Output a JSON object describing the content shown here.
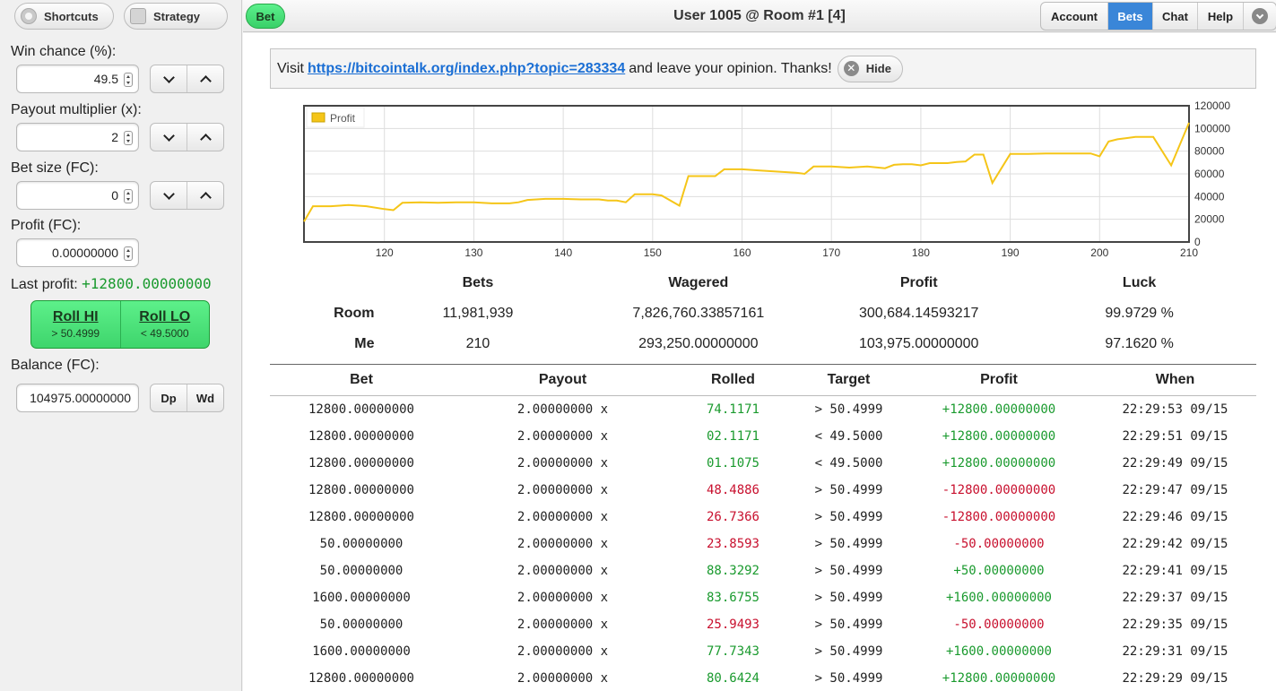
{
  "sidebar": {
    "shortcuts_label": "Shortcuts",
    "strategy_label": "Strategy",
    "win_chance_label": "Win chance (%):",
    "win_chance_value": "49.5",
    "payout_label": "Payout multiplier (x):",
    "payout_value": "2",
    "bet_size_label": "Bet size (FC):",
    "bet_size_value": "0",
    "profit_label": "Profit (FC):",
    "profit_value": "0.00000000",
    "last_profit_label": "Last profit:",
    "last_profit_value": "+12800.00000000",
    "roll_hi_label": "Roll HI",
    "roll_hi_sub": "> 50.4999",
    "roll_lo_label": "Roll LO",
    "roll_lo_sub": "< 49.5000",
    "balance_label": "Balance (FC):",
    "balance_value": "104975.00000000",
    "deposit_label": "Dp",
    "withdraw_label": "Wd"
  },
  "header": {
    "bet_tab": "Bet",
    "title": "User 1005 @ Room #1 [4]",
    "nav": [
      "Account",
      "Bets",
      "Chat",
      "Help"
    ],
    "active_nav": "Bets"
  },
  "notice": {
    "prefix": "Visit",
    "link": "https://bitcointalk.org/index.php?topic=283334",
    "suffix": "and leave your opinion. Thanks!",
    "hide_label": "Hide"
  },
  "chart_data": {
    "type": "line",
    "legend": "Profit",
    "legend_position": "top-left",
    "series_color": "#f5c518",
    "grid": true,
    "xlim": [
      111,
      210
    ],
    "ylim": [
      0,
      120000
    ],
    "xticks": [
      120,
      130,
      140,
      150,
      160,
      170,
      180,
      190,
      200,
      210
    ],
    "yticks": [
      0,
      20000,
      40000,
      60000,
      80000,
      100000,
      120000
    ],
    "series": [
      {
        "name": "Profit",
        "x": [
          111,
          112,
          114,
          116,
          118,
          120,
          121,
          122,
          124,
          126,
          128,
          130,
          132,
          134,
          135,
          136,
          138,
          140,
          142,
          144,
          145,
          146,
          147,
          148,
          150,
          151,
          153,
          154,
          155,
          156,
          157,
          158,
          160,
          162,
          164,
          166,
          167,
          168,
          170,
          172,
          173,
          174,
          176,
          177,
          178,
          179,
          180,
          181,
          183,
          184,
          185,
          186,
          187,
          188,
          190,
          192,
          194,
          195,
          196,
          197,
          199,
          200,
          201,
          202,
          203,
          204,
          206,
          208,
          210
        ],
        "y": [
          18000,
          31500,
          31500,
          32500,
          31500,
          29000,
          28000,
          34500,
          35000,
          34500,
          35000,
          35000,
          34000,
          34000,
          35000,
          37000,
          38000,
          38000,
          37500,
          37500,
          36500,
          36500,
          35000,
          42000,
          42000,
          41000,
          32000,
          58000,
          58000,
          58000,
          58000,
          64000,
          64000,
          63000,
          62000,
          61000,
          60000,
          66500,
          66500,
          65500,
          66000,
          66500,
          65000,
          68000,
          68500,
          68500,
          67500,
          69500,
          69500,
          70500,
          71000,
          77000,
          77000,
          52000,
          77500,
          77500,
          78000,
          78000,
          78000,
          78000,
          78000,
          75500,
          88500,
          90500,
          91500,
          92500,
          92500,
          67500,
          105000
        ]
      }
    ]
  },
  "stats": {
    "headers": [
      "",
      "Bets",
      "Wagered",
      "Profit",
      "Luck"
    ],
    "rows": [
      [
        "Room",
        "11,981,939",
        "7,826,760.33857161",
        "300,684.14593217",
        "99.9729 %"
      ],
      [
        "Me",
        "210",
        "293,250.00000000",
        "103,975.00000000",
        "97.1620 %"
      ]
    ]
  },
  "bets_table": {
    "headers": [
      "Bet",
      "Payout",
      "Rolled",
      "Target",
      "Profit",
      "When"
    ],
    "rows": [
      {
        "bet": "12800.00000000",
        "payout": "2.00000000 x",
        "rolled": "74.1171",
        "target": "> 50.4999",
        "profit": "+12800.00000000",
        "when": "22:29:53 09/15",
        "win": true
      },
      {
        "bet": "12800.00000000",
        "payout": "2.00000000 x",
        "rolled": "02.1171",
        "target": "< 49.5000",
        "profit": "+12800.00000000",
        "when": "22:29:51 09/15",
        "win": true
      },
      {
        "bet": "12800.00000000",
        "payout": "2.00000000 x",
        "rolled": "01.1075",
        "target": "< 49.5000",
        "profit": "+12800.00000000",
        "when": "22:29:49 09/15",
        "win": true
      },
      {
        "bet": "12800.00000000",
        "payout": "2.00000000 x",
        "rolled": "48.4886",
        "target": "> 50.4999",
        "profit": "-12800.00000000",
        "when": "22:29:47 09/15",
        "win": false
      },
      {
        "bet": "12800.00000000",
        "payout": "2.00000000 x",
        "rolled": "26.7366",
        "target": "> 50.4999",
        "profit": "-12800.00000000",
        "when": "22:29:46 09/15",
        "win": false
      },
      {
        "bet": "50.00000000",
        "payout": "2.00000000 x",
        "rolled": "23.8593",
        "target": "> 50.4999",
        "profit": "-50.00000000",
        "when": "22:29:42 09/15",
        "win": false
      },
      {
        "bet": "50.00000000",
        "payout": "2.00000000 x",
        "rolled": "88.3292",
        "target": "> 50.4999",
        "profit": "+50.00000000",
        "when": "22:29:41 09/15",
        "win": true
      },
      {
        "bet": "1600.00000000",
        "payout": "2.00000000 x",
        "rolled": "83.6755",
        "target": "> 50.4999",
        "profit": "+1600.00000000",
        "when": "22:29:37 09/15",
        "win": true
      },
      {
        "bet": "50.00000000",
        "payout": "2.00000000 x",
        "rolled": "25.9493",
        "target": "> 50.4999",
        "profit": "-50.00000000",
        "when": "22:29:35 09/15",
        "win": false
      },
      {
        "bet": "1600.00000000",
        "payout": "2.00000000 x",
        "rolled": "77.7343",
        "target": "> 50.4999",
        "profit": "+1600.00000000",
        "when": "22:29:31 09/15",
        "win": true
      },
      {
        "bet": "12800.00000000",
        "payout": "2.00000000 x",
        "rolled": "80.6424",
        "target": "> 50.4999",
        "profit": "+12800.00000000",
        "when": "22:29:29 09/15",
        "win": true
      }
    ]
  }
}
